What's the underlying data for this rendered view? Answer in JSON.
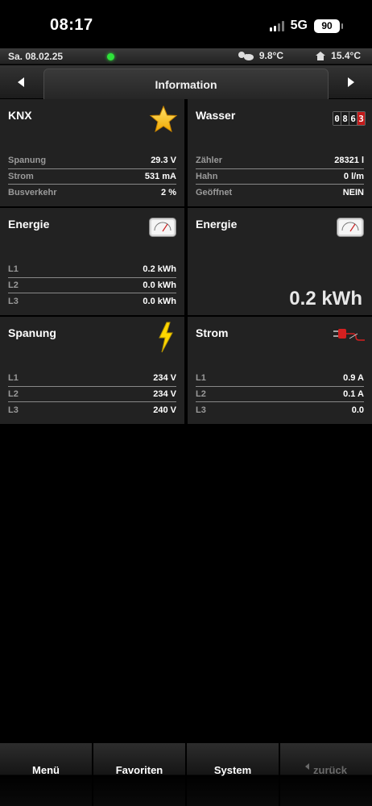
{
  "status_bar": {
    "time": "08:17",
    "network": "5G",
    "battery": "90"
  },
  "info_bar": {
    "date": "Sa. 08.02.25",
    "outdoor_temp": "9.8°C",
    "indoor_temp": "15.4°C",
    "status_color": "#2ee23a"
  },
  "nav": {
    "title": "Information"
  },
  "tiles": {
    "knx": {
      "title": "KNX",
      "icon": "star-icon",
      "rows": [
        {
          "label": "Spanung",
          "value": "29.3 V"
        },
        {
          "label": "Strom",
          "value": "531 mA"
        },
        {
          "label": "Busverkehr",
          "value": "2 %"
        }
      ]
    },
    "wasser": {
      "title": "Wasser",
      "icon": "counter-icon",
      "counter_digits": [
        "0",
        "8",
        "6",
        "3"
      ],
      "rows": [
        {
          "label": "Zähler",
          "value": "28321 l"
        },
        {
          "label": "Hahn",
          "value": "0 l/m"
        },
        {
          "label": "Geöffnet",
          "value": "NEIN"
        }
      ]
    },
    "energie1": {
      "title": "Energie",
      "icon": "meter-icon",
      "rows": [
        {
          "label": "L1",
          "value": "0.2 kWh"
        },
        {
          "label": "L2",
          "value": "0.0 kWh"
        },
        {
          "label": "L3",
          "value": "0.0 kWh"
        }
      ]
    },
    "energie2": {
      "title": "Energie",
      "icon": "meter-icon",
      "big_value": "0.2 kWh"
    },
    "spanung": {
      "title": "Spanung",
      "icon": "lightning-icon",
      "rows": [
        {
          "label": "L1",
          "value": "234 V"
        },
        {
          "label": "L2",
          "value": "234 V"
        },
        {
          "label": "L3",
          "value": "240 V"
        }
      ]
    },
    "strom": {
      "title": "Strom",
      "icon": "plug-icon",
      "rows": [
        {
          "label": "L1",
          "value": "0.9 A"
        },
        {
          "label": "L2",
          "value": "0.1 A"
        },
        {
          "label": "L3",
          "value": "0.0"
        }
      ]
    }
  },
  "tabbar": {
    "menu": "Menü",
    "favorites": "Favoriten",
    "system": "System",
    "back": "zurück"
  }
}
